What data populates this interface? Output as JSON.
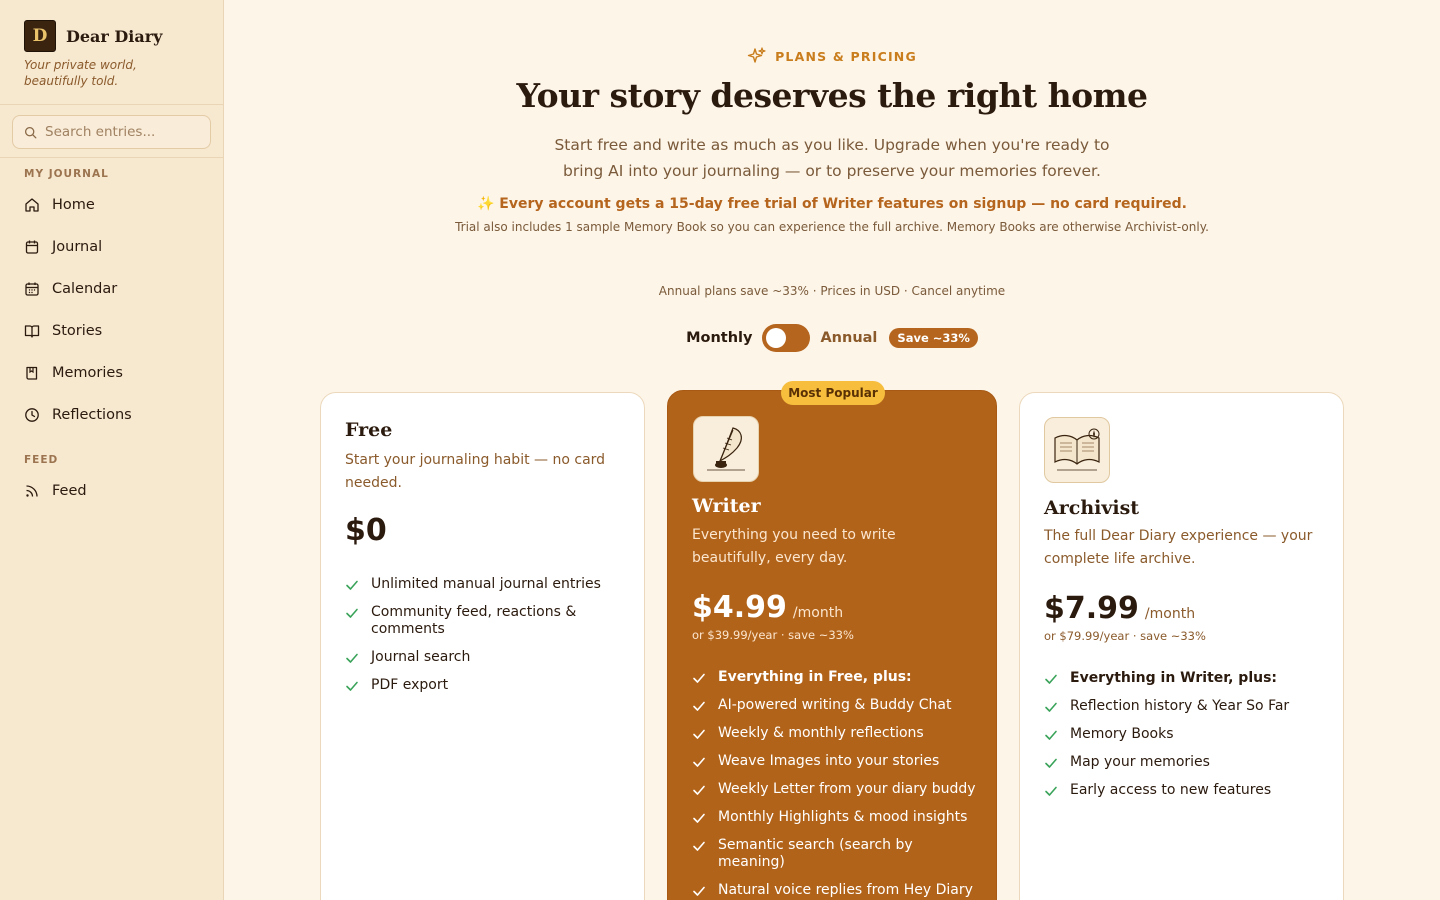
{
  "sidebar": {
    "brand": {
      "name": "Dear Diary",
      "tagline": "Your private world, beautifully told.",
      "logo_letter": "D"
    },
    "search": {
      "placeholder": "Search entries..."
    },
    "sections": [
      {
        "label": "MY JOURNAL",
        "items": [
          {
            "label": "Home",
            "icon": "home-icon"
          },
          {
            "label": "Journal",
            "icon": "notebook-icon"
          },
          {
            "label": "Calendar",
            "icon": "calendar-icon"
          },
          {
            "label": "Stories",
            "icon": "book-open-icon"
          },
          {
            "label": "Memories",
            "icon": "bookmark-book-icon"
          },
          {
            "label": "Reflections",
            "icon": "clock-icon"
          }
        ]
      },
      {
        "label": "FEED",
        "items": [
          {
            "label": "Feed",
            "icon": "rss-icon"
          }
        ]
      }
    ]
  },
  "header": {
    "eyebrow": "PLANS & PRICING",
    "title": "Your story deserves the right home",
    "subtitle": "Start free and write as much as you like. Upgrade when you're ready to bring AI into your journaling — or to preserve your memories forever.",
    "trial": "✨ Every account gets a 15-day free trial of Writer features on signup — no card required.",
    "trial_note": "Trial also includes 1 sample Memory Book so you can experience the full archive. Memory Books are otherwise Archivist-only.",
    "fine_print": "Annual plans save ~33% · Prices in USD · Cancel anytime"
  },
  "billing_toggle": {
    "monthly": "Monthly",
    "annual": "Annual",
    "save_badge": "Save ~33%",
    "selected": "Monthly"
  },
  "plans": {
    "free": {
      "name": "Free",
      "description": "Start your journaling habit — no card needed.",
      "price": "$0",
      "features": [
        "Unlimited manual journal entries",
        "Community feed, reactions & comments",
        "Journal search",
        "PDF export"
      ]
    },
    "writer": {
      "badge": "Most Popular",
      "name": "Writer",
      "description": "Everything you need to write beautifully, every day.",
      "price": "$4.99",
      "period": "/month",
      "annual_note": "or $39.99/year · save ~33%",
      "features": [
        "Everything in Free, plus:",
        "AI-powered writing & Buddy Chat",
        "Weekly & monthly reflections",
        "Weave Images into your stories",
        "Weekly Letter from your diary buddy",
        "Monthly Highlights & mood insights",
        "Semantic search (search by meaning)",
        "Natural voice replies from Hey Diary"
      ]
    },
    "archivist": {
      "name": "Archivist",
      "description": "The full Dear Diary experience — your complete life archive.",
      "price": "$7.99",
      "period": "/month",
      "annual_note": "or $79.99/year · save ~33%",
      "features": [
        "Everything in Writer, plus:",
        "Reflection history & Year So Far",
        "Memory Books",
        "Map your memories",
        "Early access to new features"
      ]
    }
  },
  "colors": {
    "accent": "#b5651d",
    "popular_badge": "#f6be3c",
    "check_green": "#3aa35a",
    "background": "#fdf5e8",
    "sidebar": "#f7e8d0"
  }
}
